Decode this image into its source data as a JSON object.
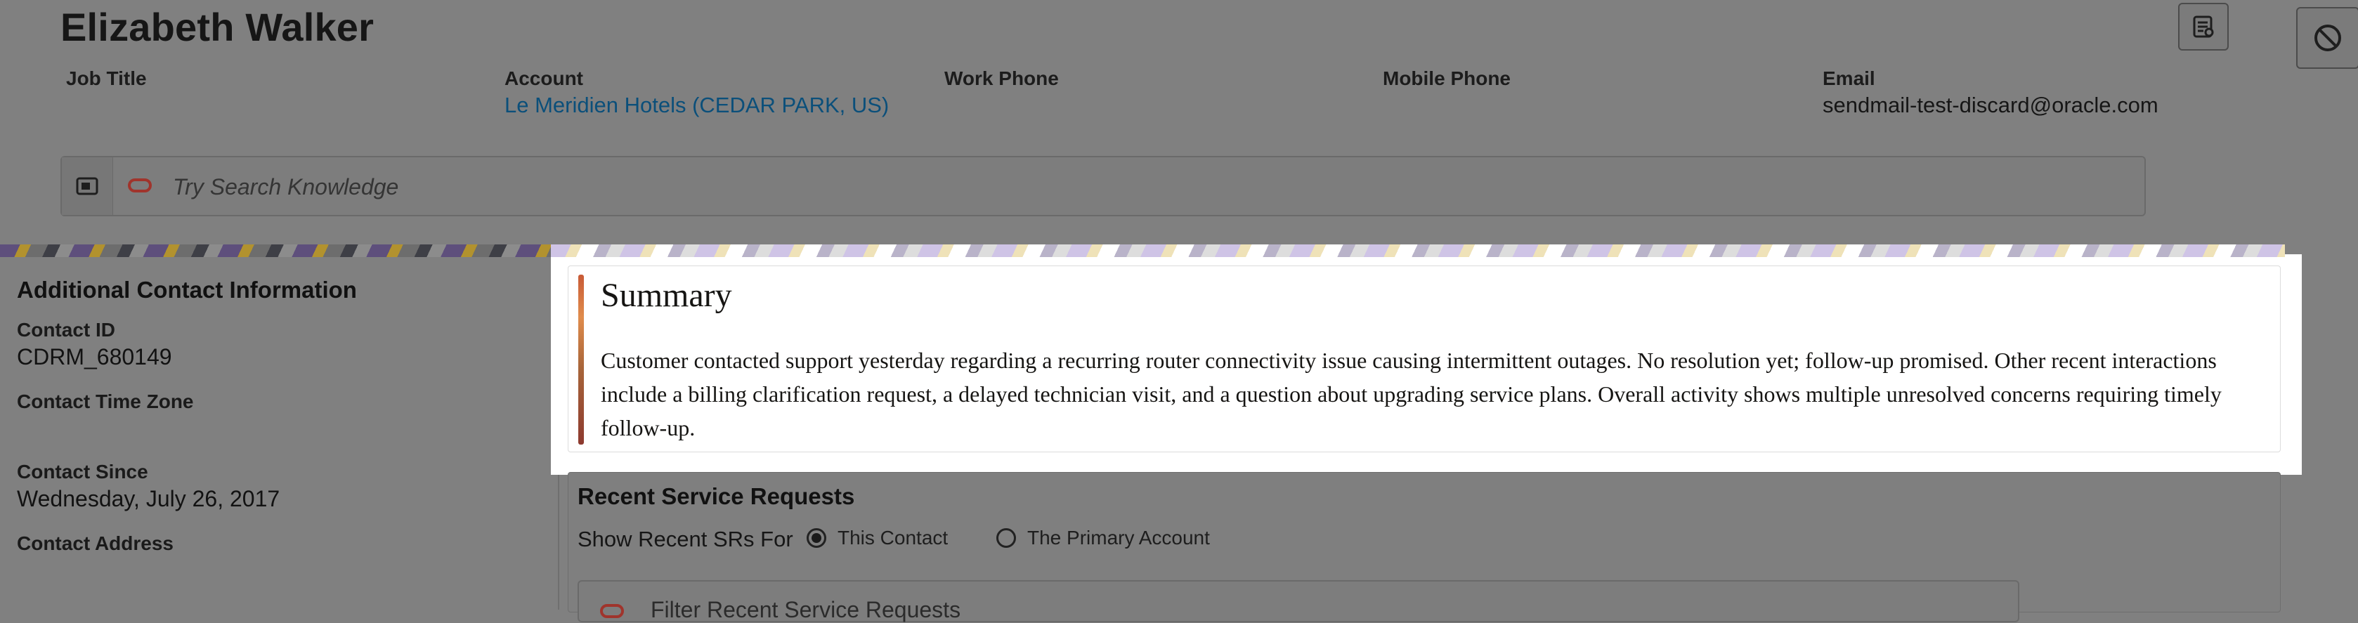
{
  "header": {
    "name": "Elizabeth Walker",
    "fields": [
      {
        "label": "Job Title",
        "value": ""
      },
      {
        "label": "Account",
        "value": "Le Meridien Hotels (CEDAR PARK, US)"
      },
      {
        "label": "Work Phone",
        "value": ""
      },
      {
        "label": "Mobile Phone",
        "value": ""
      },
      {
        "label": "Email",
        "value": "sendmail-test-discard@oracle.com"
      }
    ],
    "icons": {
      "report": "report-icon",
      "block": "block-icon"
    }
  },
  "search": {
    "placeholder": "Try Search Knowledge",
    "icons": {
      "panel": "panel-toggle-icon",
      "oval": "oracle-oval-icon"
    }
  },
  "contact_info": {
    "title": "Additional Contact Information",
    "items": [
      {
        "label": "Contact ID",
        "value": "CDRM_680149"
      },
      {
        "label": "Contact Time Zone",
        "value": ""
      },
      {
        "label": "Contact Since",
        "value": "Wednesday, July 26, 2017"
      },
      {
        "label": "Contact Address",
        "value": ""
      }
    ]
  },
  "summary": {
    "title": "Summary",
    "text": "Customer contacted support yesterday regarding a recurring router connectivity issue causing intermittent outages. No resolution yet; follow-up promised. Other recent interactions include a billing clarification request, a delayed technician visit, and a question about upgrading service plans. Overall activity shows multiple unresolved concerns requiring timely follow-up."
  },
  "recent_srs": {
    "title": "Recent Service Requests",
    "show_for_label": "Show Recent SRs For",
    "options": [
      {
        "label": "This Contact",
        "selected": true
      },
      {
        "label": "The Primary Account",
        "selected": false
      }
    ],
    "filter_placeholder": "Filter Recent Service Requests"
  }
}
